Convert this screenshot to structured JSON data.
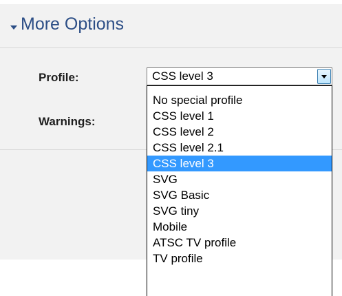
{
  "section": {
    "title": "More Options"
  },
  "form": {
    "profile_label": "Profile:",
    "warnings_label": "Warnings:"
  },
  "profile_select": {
    "value": "CSS level 3",
    "options": [
      "No special profile",
      "CSS level 1",
      "CSS level 2",
      "CSS level 2.1",
      "CSS level 3",
      "SVG",
      "SVG Basic",
      "SVG tiny",
      "Mobile",
      "ATSC TV profile",
      "TV profile"
    ],
    "highlighted_option": "CSS level 3"
  },
  "colors": {
    "title": "#2c4e86",
    "highlight": "#3399ff",
    "panel_bg": "#f2f2f2"
  }
}
